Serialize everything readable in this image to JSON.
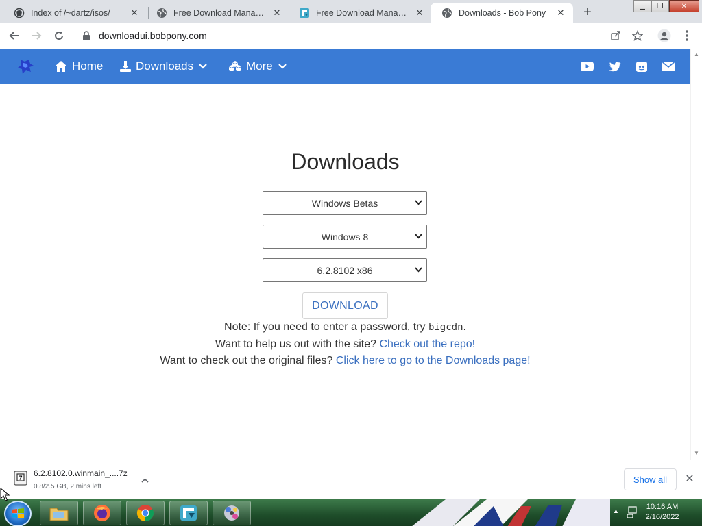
{
  "browser": {
    "tabs": [
      {
        "title": "Index of /~dartz/isos/",
        "icon": "page-icon",
        "active": false
      },
      {
        "title": "Free Download Manager -",
        "icon": "globe-icon",
        "active": false
      },
      {
        "title": "Free Download Manager -",
        "icon": "fdm-icon",
        "active": false
      },
      {
        "title": "Downloads - Bob Pony",
        "icon": "globe-icon",
        "active": true
      }
    ],
    "new_tab": "+",
    "url": "downloadui.bobpony.com"
  },
  "site": {
    "nav": {
      "home": "Home",
      "downloads": "Downloads",
      "more": "More"
    },
    "social": [
      "youtube-icon",
      "twitter-icon",
      "discord-icon",
      "mail-icon"
    ],
    "accent_color": "#3a7bd5"
  },
  "main": {
    "title": "Downloads",
    "selects": [
      {
        "value": "Windows Betas"
      },
      {
        "value": "Windows 8"
      },
      {
        "value": "6.2.8102 x86"
      }
    ],
    "download_label": "DOWNLOAD",
    "note": {
      "prefix": "Note: If you need to enter a password, try ",
      "code": "bigcdn",
      "suffix": "."
    },
    "help": {
      "prefix": "Want to help us out with the site? ",
      "link": "Check out the repo!"
    },
    "original": {
      "prefix": "Want to check out the original files? ",
      "link": "Click here to go to the Downloads page!"
    }
  },
  "shelf": {
    "filename": "6.2.8102.0.winmain_....7z",
    "status": "0.8/2.5 GB, 2 mins left",
    "show_all": "Show all",
    "close": "✕"
  },
  "taskbar": {
    "time": "10:16 AM",
    "date": "2/16/2022"
  }
}
